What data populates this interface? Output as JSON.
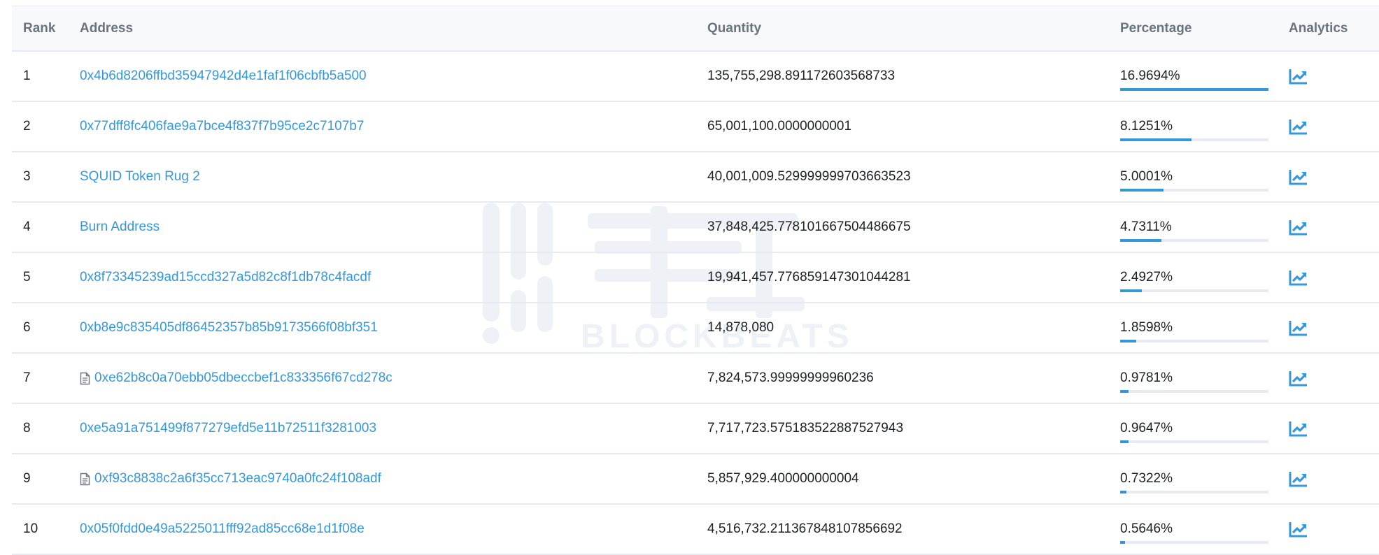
{
  "table": {
    "headers": {
      "rank": "Rank",
      "address": "Address",
      "quantity": "Quantity",
      "percentage": "Percentage",
      "analytics": "Analytics"
    },
    "rows": [
      {
        "rank": "1",
        "address": "0x4b6d8206ffbd35947942d4e1faf1f06cbfb5a500",
        "contract": false,
        "quantity": "135,755,298.891172603568733",
        "percentage": "16.9694%",
        "pct_value": 16.9694
      },
      {
        "rank": "2",
        "address": "0x77dff8fc406fae9a7bce4f837f7b95ce2c7107b7",
        "contract": false,
        "quantity": "65,001,100.0000000001",
        "percentage": "8.1251%",
        "pct_value": 8.1251
      },
      {
        "rank": "3",
        "address": "SQUID Token Rug 2",
        "contract": false,
        "quantity": "40,001,009.529999999703663523",
        "percentage": "5.0001%",
        "pct_value": 5.0001
      },
      {
        "rank": "4",
        "address": "Burn Address",
        "contract": false,
        "quantity": "37,848,425.778101667504486675",
        "percentage": "4.7311%",
        "pct_value": 4.7311
      },
      {
        "rank": "5",
        "address": "0x8f73345239ad15ccd327a5d82c8f1db78c4facdf",
        "contract": false,
        "quantity": "19,941,457.776859147301044281",
        "percentage": "2.4927%",
        "pct_value": 2.4927
      },
      {
        "rank": "6",
        "address": "0xb8e9c835405df86452357b85b9173566f08bf351",
        "contract": false,
        "quantity": "14,878,080",
        "percentage": "1.8598%",
        "pct_value": 1.8598
      },
      {
        "rank": "7",
        "address": "0xe62b8c0a70ebb05dbeccbef1c833356f67cd278c",
        "contract": true,
        "quantity": "7,824,573.99999999960236",
        "percentage": "0.9781%",
        "pct_value": 0.9781
      },
      {
        "rank": "8",
        "address": "0xe5a91a751499f877279efd5e11b72511f3281003",
        "contract": false,
        "quantity": "7,717,723.575183522887527943",
        "percentage": "0.9647%",
        "pct_value": 0.9647
      },
      {
        "rank": "9",
        "address": "0xf93c8838c2a6f35cc713eac9740a0fc24f108adf",
        "contract": true,
        "quantity": "5,857,929.400000000004",
        "percentage": "0.7322%",
        "pct_value": 0.7322
      },
      {
        "rank": "10",
        "address": "0x05f0fdd0e49a5225011fff92ad85cc68e1d1f08e",
        "contract": false,
        "quantity": "4,516,732.211367848107856692",
        "percentage": "0.5646%",
        "pct_value": 0.5646
      }
    ]
  },
  "watermark": {
    "text": "BLOCKBEATS"
  },
  "icons": {
    "contract": "document-icon",
    "analytics": "chart-line-up-icon"
  },
  "colors": {
    "link": "#3498db",
    "header_bg": "#f8f9fa",
    "border": "#e7eaf3",
    "watermark": "#eef1f6"
  }
}
